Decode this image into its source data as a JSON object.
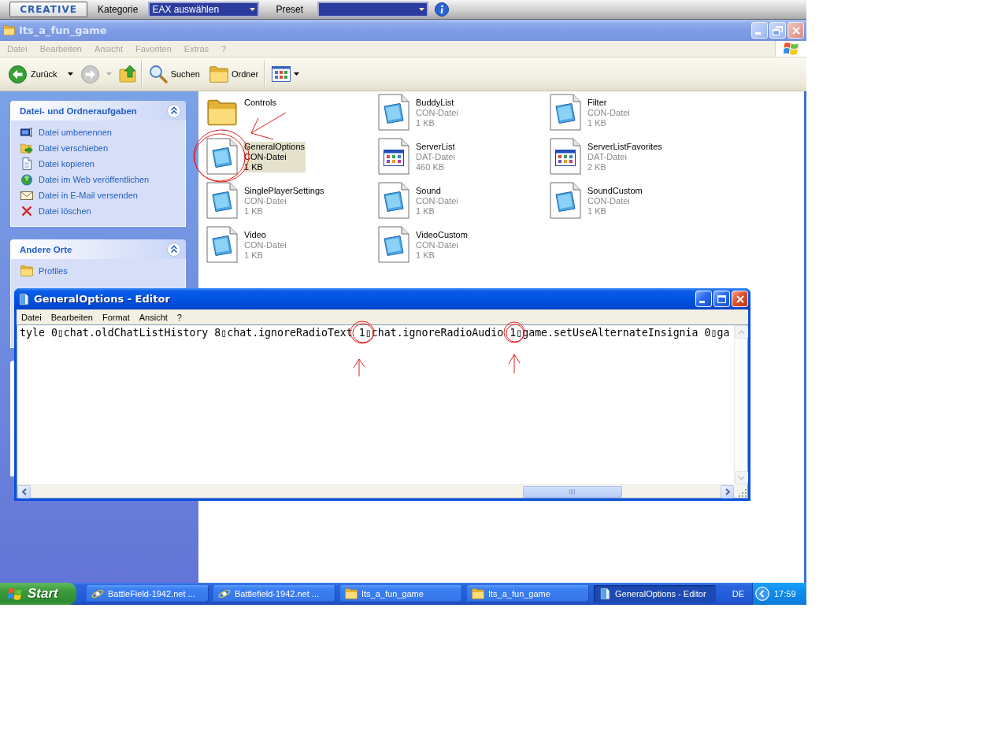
{
  "creative_bar": {
    "logo": "CREATIVE",
    "category_label": "Kategorie",
    "category_value": "EAX auswählen",
    "preset_label": "Preset"
  },
  "explorer": {
    "title": "Its_a_fun_game",
    "active": false,
    "menu": [
      "Datei",
      "Bearbeiten",
      "Ansicht",
      "Favoriten",
      "Extras",
      "?"
    ],
    "toolbar": {
      "back": "Zurück",
      "forward_disabled": true,
      "search": "Suchen",
      "folders": "Ordner"
    },
    "task_panels": [
      {
        "title": "Datei- und Ordneraufgaben",
        "expanded": true,
        "items": [
          {
            "label": "Datei umbenennen",
            "kind": "rename"
          },
          {
            "label": "Datei verschieben",
            "kind": "move"
          },
          {
            "label": "Datei kopieren",
            "kind": "copy"
          },
          {
            "label": "Datei im Web veröffentlichen",
            "kind": "publish"
          },
          {
            "label": "Datei in E-Mail versenden",
            "kind": "email"
          },
          {
            "label": "Datei löschen",
            "kind": "delete"
          }
        ]
      },
      {
        "title": "Andere Orte",
        "expanded": true,
        "items": [
          {
            "label": "Profiles",
            "kind": "folder"
          }
        ]
      }
    ],
    "files": [
      {
        "name": "Controls",
        "kind": "folder",
        "selected": false
      },
      {
        "name": "BuddyList",
        "type": "CON-Datei",
        "size": "1 KB",
        "kind": "config",
        "selected": false
      },
      {
        "name": "Filter",
        "type": "CON-Datei",
        "size": "1 KB",
        "kind": "config",
        "selected": false
      },
      {
        "name": "GeneralOptions",
        "type": "CON-Datei",
        "size": "1 KB",
        "kind": "config",
        "selected": true
      },
      {
        "name": "ServerList",
        "type": "DAT-Datei",
        "size": "460 KB",
        "kind": "data",
        "selected": false
      },
      {
        "name": "ServerListFavorites",
        "type": "DAT-Datei",
        "size": "2 KB",
        "kind": "data",
        "selected": false
      },
      {
        "name": "SinglePlayerSettings",
        "type": "CON-Datei",
        "size": "1 KB",
        "kind": "config",
        "selected": false
      },
      {
        "name": "Sound",
        "type": "CON-Datei",
        "size": "1 KB",
        "kind": "config",
        "selected": false
      },
      {
        "name": "SoundCustom",
        "type": "CON-Datei",
        "size": "1 KB",
        "kind": "config",
        "selected": false
      },
      {
        "name": "Video",
        "type": "CON-Datei",
        "size": "1 KB",
        "kind": "config",
        "selected": false
      },
      {
        "name": "VideoCustom",
        "type": "CON-Datei",
        "size": "1 KB",
        "kind": "config",
        "selected": false
      }
    ]
  },
  "editor": {
    "title": "GeneralOptions - Editor",
    "active": true,
    "menu": [
      "Datei",
      "Bearbeiten",
      "Format",
      "Ansicht",
      "?"
    ],
    "text": "tyle 0▯chat.oldChatListHistory 8▯chat.ignoreRadioText 1▯chat.ignoreRadioAudio 1▯game.setUseAlternateInsignia 0▯ga"
  },
  "taskbar": {
    "start": "Start",
    "tasks": [
      {
        "label": "BattleField-1942.net ...",
        "kind": "browser",
        "selected": false
      },
      {
        "label": "Battlefield-1942.net ...",
        "kind": "browser",
        "selected": false
      },
      {
        "label": "Its_a_fun_game",
        "kind": "folder",
        "selected": false
      },
      {
        "label": "Its_a_fun_game",
        "kind": "folder",
        "selected": false
      },
      {
        "label": "GeneralOptions - Editor",
        "kind": "editor",
        "selected": true
      }
    ],
    "language": "DE",
    "clock": "17:59"
  }
}
